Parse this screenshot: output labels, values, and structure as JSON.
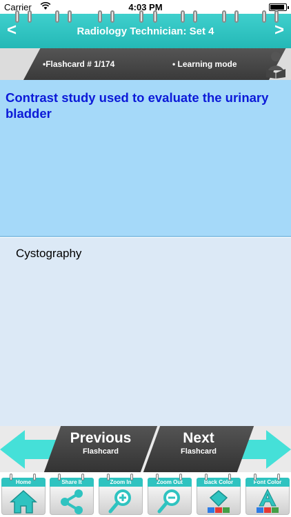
{
  "status": {
    "carrier": "Carrier",
    "time": "4:03 PM",
    "battery_level": 0.9
  },
  "header": {
    "title": "Radiology Technician: Set 4",
    "back_label": "<",
    "forward_label": ">"
  },
  "info": {
    "counter": "•Flashcard #  1/174",
    "mode": "• Learning mode"
  },
  "card": {
    "question": " Contrast study used to evaluate the urinary bladder",
    "answer": "Cystography"
  },
  "navigation": {
    "previous": {
      "main": "Previous",
      "sub": "Flashcard"
    },
    "next": {
      "main": "Next",
      "sub": "Flashcard"
    }
  },
  "toolbar": {
    "home": "Home",
    "share": "Share It",
    "zoom_in": "Zoom In",
    "zoom_out": "Zoom Out",
    "back_color": "Back Color",
    "font_color": "Font Color"
  },
  "colors": {
    "accent": "#2fc3c0",
    "question_bg": "#a5d9f9",
    "question_text": "#0c1ad8",
    "answer_bg": "#dce9f6"
  }
}
